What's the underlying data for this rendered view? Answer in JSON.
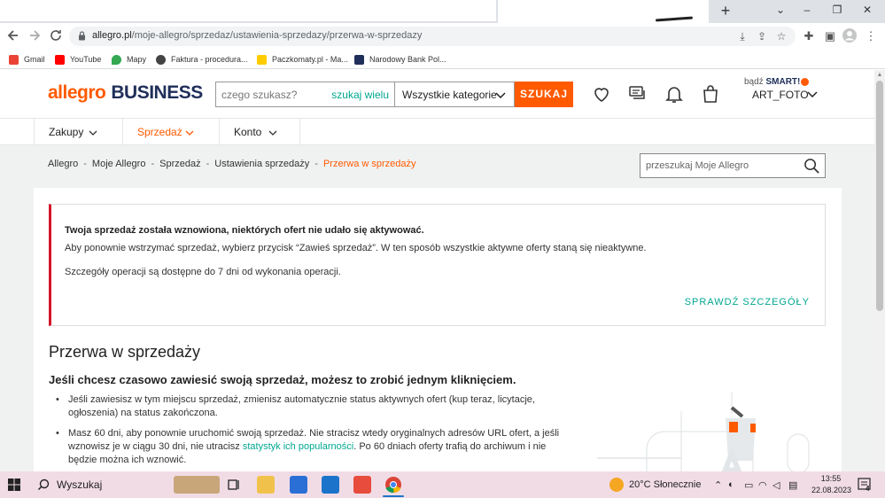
{
  "browser": {
    "new_tab": "+",
    "window_controls": {
      "minimize": "⌄",
      "min": "–",
      "max": "❐",
      "close": "✕"
    },
    "url_host": "allegro.pl",
    "url_path": "/moje-allegro/sprzedaz/ustawienia-sprzedazy/przerwa-w-sprzedazy",
    "bookmarks": [
      {
        "label": "Gmail",
        "color": "#ea4335"
      },
      {
        "label": "YouTube",
        "color": "#ff0000"
      },
      {
        "label": "Mapy",
        "color": "#34a853"
      },
      {
        "label": "Faktura - procedura...",
        "color": "#444444"
      },
      {
        "label": "Paczkomaty.pl - Ma...",
        "color": "#ffcc00"
      },
      {
        "label": "Narodowy Bank Pol...",
        "color": "#1f2f5a"
      }
    ]
  },
  "header": {
    "logo_allegro": "allegro",
    "logo_business": "BUSINESS",
    "search_placeholder": "czego szukasz?",
    "search_many": "szukaj wielu",
    "category": "Wszystkie kategorie",
    "search_button": "SZUKAJ",
    "smart_prefix": "bądź",
    "smart_label": "SMART!",
    "username": "ART_FOTO"
  },
  "menu": [
    {
      "label": "Zakupy"
    },
    {
      "label": "Sprzedaż"
    },
    {
      "label": "Konto"
    }
  ],
  "breadcrumb": {
    "items": [
      "Allegro",
      "Moje Allegro",
      "Sprzedaż",
      "Ustawienia sprzedaży"
    ],
    "current": "Przerwa w sprzedaży"
  },
  "page_search_placeholder": "przeszukaj Moje Allegro",
  "notice": {
    "title": "Twoja sprzedaż została wznowiona, niektórych ofert nie udało się aktywować.",
    "line1": "Aby ponownie wstrzymać sprzedaż, wybierz przycisk “Zawieś sprzedaż”. W ten sposób wszystkie aktywne oferty staną się nieaktywne.",
    "line2": "Szczegóły operacji są dostępne do 7 dni od wykonania operacji.",
    "link": "SPRAWDŹ SZCZEGÓŁY"
  },
  "section": {
    "title": "Przerwa w sprzedaży",
    "subtitle": "Jeśli chcesz czasowo zawiesić swoją sprzedaż, możesz to zrobić jednym kliknięciem.",
    "bullet1": "Jeśli zawiesisz w tym miejscu sprzedaż, zmienisz automatycznie status aktywnych ofert (kup teraz, licytacje, ogłoszenia) na status zakończona.",
    "bullet2_a": "Masz 60 dni, aby ponownie uruchomić swoją sprzedaż. Nie stracisz wtedy oryginalnych adresów URL ofert, a jeśli wznowisz je w ciągu 30 dni, nie utracisz ",
    "bullet2_link": "statystyk ich popularności",
    "bullet2_b": ". Po 60 dniach oferty trafią do archiwum i nie będzie można ich wznowić."
  },
  "taskbar": {
    "search_label": "Wyszukaj",
    "weather": "20°C  Słonecznie",
    "time": "13:55",
    "date": "22.08.2023",
    "notifications": "4"
  },
  "colors": {
    "accent": "#ff5a00",
    "link": "#00a790",
    "error": "#d4152b"
  }
}
